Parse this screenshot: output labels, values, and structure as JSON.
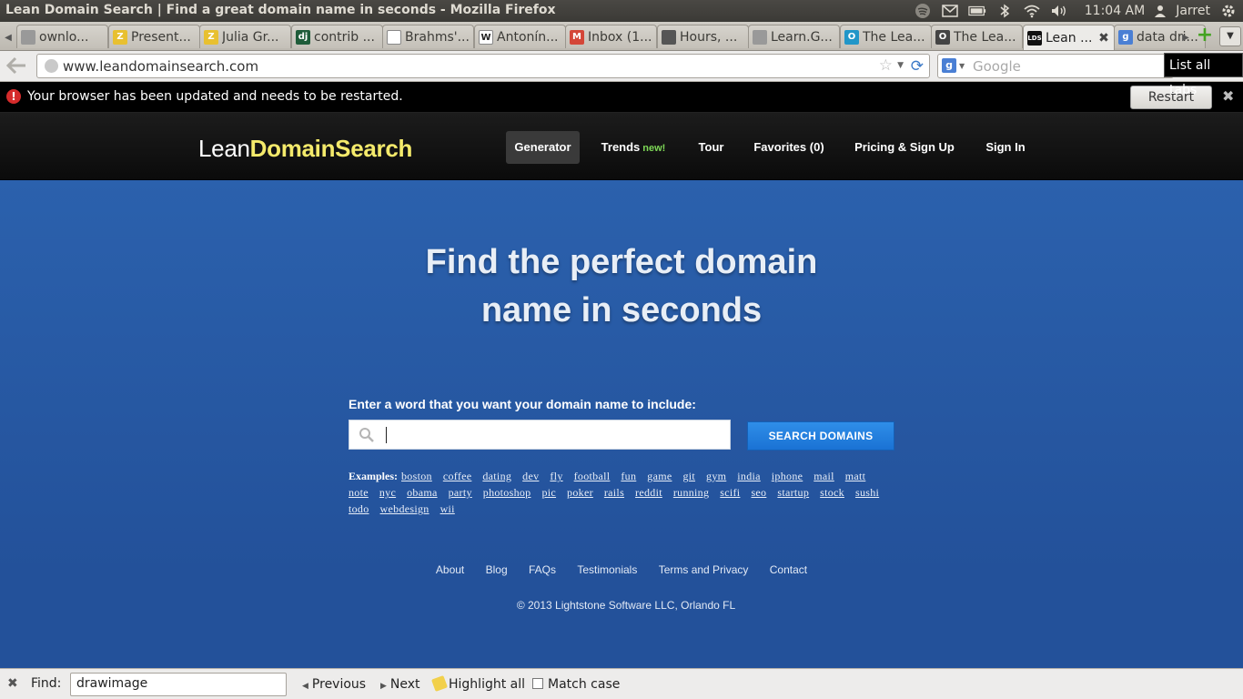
{
  "os": {
    "window_title": "Lean Domain Search | Find a great domain name in seconds - Mozilla Firefox",
    "clock": "11:04 AM",
    "user": "Jarret"
  },
  "tabs": [
    {
      "label": "ownlo...",
      "icon": "generic-icon",
      "icon_color": "#999999",
      "icon_text": ""
    },
    {
      "label": "Present...",
      "icon": "zip-icon",
      "icon_color": "#e8c030",
      "icon_text": "Z"
    },
    {
      "label": "Julia Gr...",
      "icon": "zip-icon",
      "icon_color": "#e8c030",
      "icon_text": "Z"
    },
    {
      "label": "contrib ...",
      "icon": "django-icon",
      "icon_color": "#1f5c3a",
      "icon_text": "dj"
    },
    {
      "label": "Brahms'...",
      "icon": "generic-icon",
      "icon_color": "#ffffff",
      "icon_text": ""
    },
    {
      "label": "Antonín...",
      "icon": "wikipedia-icon",
      "icon_color": "#ffffff",
      "icon_text": "W"
    },
    {
      "label": "Inbox (1...",
      "icon": "gmail-icon",
      "icon_color": "#d44638",
      "icon_text": "M"
    },
    {
      "label": "Hours, ...",
      "icon": "chart-icon",
      "icon_color": "#555555",
      "icon_text": ""
    },
    {
      "label": "Learn.G...",
      "icon": "generic-icon",
      "icon_color": "#999999",
      "icon_text": ""
    },
    {
      "label": "The Lea...",
      "icon": "circle-icon",
      "icon_color": "#2196c8",
      "icon_text": "O"
    },
    {
      "label": "The Lea...",
      "icon": "circle-icon",
      "icon_color": "#444444",
      "icon_text": "O"
    },
    {
      "label": "Lean ...",
      "icon": "lds-icon",
      "icon_color": "#111111",
      "icon_text": "LDS",
      "active": true
    },
    {
      "label": "data dri...",
      "icon": "google-icon",
      "icon_color": "#4a7fd4",
      "icon_text": "g"
    }
  ],
  "browser": {
    "url": "www.leandomainsearch.com",
    "search_placeholder": "Google",
    "tooltip": "List all tabs"
  },
  "notification": {
    "message": "Your browser has been updated and needs to be restarted.",
    "button": "Restart"
  },
  "site": {
    "logo_part1": "Lean",
    "logo_part2": "DomainSearch",
    "nav": [
      {
        "label": "Generator",
        "active": true
      },
      {
        "label": "Trends",
        "badge": "new!"
      },
      {
        "label": "Tour"
      },
      {
        "label": "Favorites (0)"
      },
      {
        "label": "Pricing & Sign Up"
      },
      {
        "label": "Sign In"
      }
    ],
    "headline_line1": "Find the perfect domain",
    "headline_line2": "name in seconds",
    "prompt": "Enter a word that you want your domain name to include:",
    "search_value": "",
    "search_button": "SEARCH DOMAINS",
    "examples_label": "Examples:",
    "examples": [
      "boston",
      "coffee",
      "dating",
      "dev",
      "fly",
      "football",
      "fun",
      "game",
      "git",
      "gym",
      "india",
      "iphone",
      "mail",
      "matt",
      "note",
      "nyc",
      "obama",
      "party",
      "photoshop",
      "pic",
      "poker",
      "rails",
      "reddit",
      "running",
      "scifi",
      "seo",
      "startup",
      "stock",
      "sushi",
      "todo",
      "webdesign",
      "wii"
    ],
    "footer_links": [
      "About",
      "Blog",
      "FAQs",
      "Testimonials",
      "Terms and Privacy",
      "Contact"
    ],
    "copyright": "© 2013 Lightstone Software LLC, Orlando FL"
  },
  "findbar": {
    "label": "Find:",
    "value": "drawimage",
    "previous": "Previous",
    "next": "Next",
    "highlight_all": "Highlight all",
    "match_case": "Match case"
  }
}
